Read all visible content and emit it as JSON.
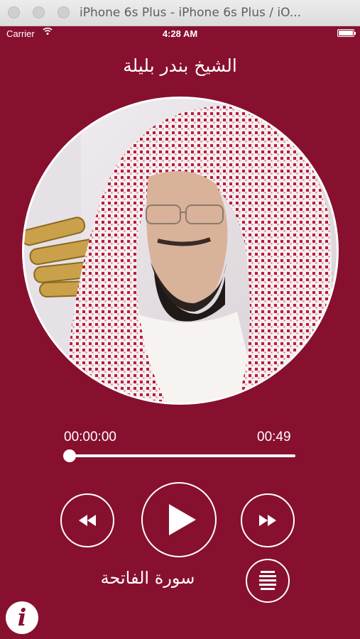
{
  "window": {
    "title": "iPhone 6s Plus - iPhone 6s Plus / iO..."
  },
  "status_bar": {
    "carrier": "Carrier",
    "time": "4:28 AM"
  },
  "player": {
    "reciter_name": "الشيخ بندر بليلة",
    "elapsed": "00:00:00",
    "duration": "00:49",
    "progress_fraction": 0.0,
    "surah_name": "سورة الفاتحة"
  },
  "icons": {
    "wifi": "wifi-icon",
    "battery": "battery-icon",
    "rewind": "rewind-icon",
    "play": "play-icon",
    "fast_forward": "fast-forward-icon",
    "menu": "list-icon",
    "info": "info-icon",
    "info_glyph": "i"
  },
  "colors": {
    "background": "#87102f",
    "foreground": "#ffffff"
  }
}
